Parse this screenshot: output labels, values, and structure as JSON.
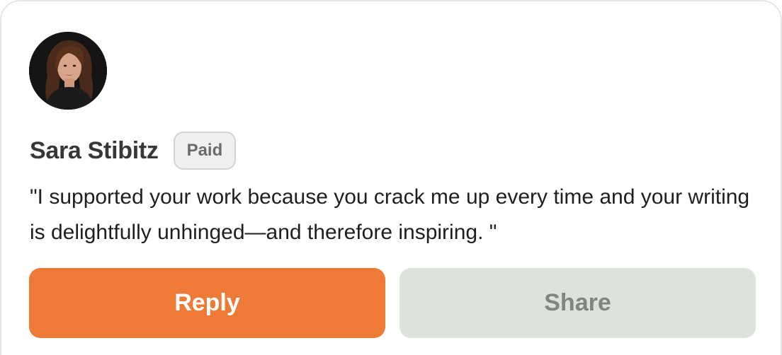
{
  "supporter": {
    "name": "Sara Stibitz",
    "badge": "Paid",
    "message": "\"I supported your work because you crack me up every time and your writing is delightfully unhinged—and therefore inspiring. \""
  },
  "actions": {
    "reply_label": "Reply",
    "share_label": "Share"
  },
  "colors": {
    "reply_bg": "#ee7a37",
    "share_bg": "#dde3dc",
    "badge_bg": "#f0f0f0",
    "name_text": "#363737"
  }
}
